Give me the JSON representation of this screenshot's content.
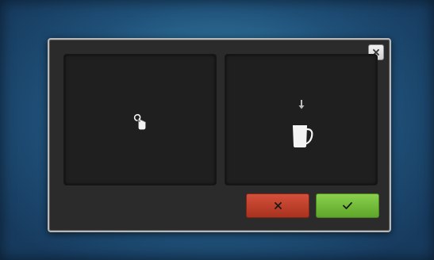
{
  "dialog": {
    "close_icon": "close-icon",
    "left_panel": {
      "icon": "touch-finger-icon"
    },
    "right_panel": {
      "arrow_icon": "arrow-down-icon",
      "pitcher_icon": "milk-pitcher-icon"
    },
    "cancel_button": {
      "icon": "cross-icon",
      "color": "#c0402c"
    },
    "confirm_button": {
      "icon": "check-icon",
      "color": "#72bb38"
    }
  },
  "colors": {
    "background": "#2d6f97",
    "dialog": "#2b2b2b",
    "panel": "#1f1f1f"
  }
}
